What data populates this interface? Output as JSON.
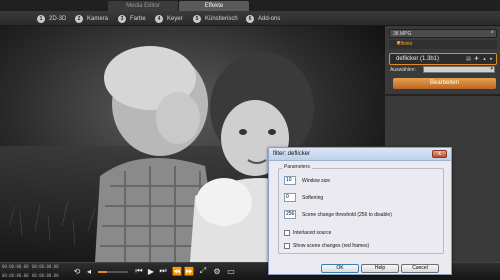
{
  "top_tabs": {
    "media_editor": "Media Editor",
    "effekte": "Effekte"
  },
  "categories": [
    {
      "num": "1",
      "label": "2D-3D"
    },
    {
      "num": "2",
      "label": "Kamera"
    },
    {
      "num": "3",
      "label": "Farbe"
    },
    {
      "num": "4",
      "label": "Keyer"
    },
    {
      "num": "5",
      "label": "Künstlerisch"
    },
    {
      "num": "6",
      "label": "Add-ons"
    }
  ],
  "side_panel": {
    "title": "38.MPG",
    "close": "×",
    "section": "Effekte",
    "effect_item": "deflicker (1.3b1)",
    "auswahlen_label": "Auswählen:",
    "edit_button": "Bearbeiten"
  },
  "dialog": {
    "title": "filter: deflicker",
    "close": "x",
    "group": "Parameters",
    "window_size": {
      "value": "10",
      "label": "Window size"
    },
    "softening": {
      "value": "0",
      "label": "Softening"
    },
    "scene_threshold": {
      "value": "256",
      "label": "Scene change threshold (256 to disable)"
    },
    "interlaced": {
      "label": "Interlaced source"
    },
    "show_scene": {
      "label": "Show scene changes (red frames)"
    },
    "ok": "OK",
    "help": "Help",
    "cancel": "Cancel"
  },
  "player": {
    "timecodes": [
      "00:00:00.00",
      "00:00:00.00",
      "00:00:00.00",
      "00:00:00.00"
    ],
    "scrub_progress": 0.3
  },
  "colors": {
    "accent": "#e08a2a",
    "panel": "#3a3a3a",
    "dialog_bg": "#eceaf1"
  }
}
